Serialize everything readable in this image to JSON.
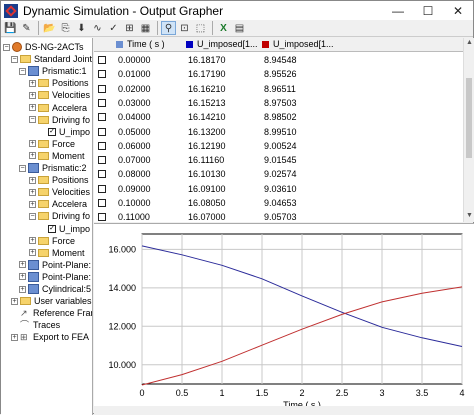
{
  "window": {
    "title": "Dynamic Simulation - Output Grapher",
    "minimize": "—",
    "maximize": "☐",
    "close": "✕"
  },
  "toolbar": {
    "icons": [
      "save-icon",
      "open-icon",
      "cut-icon",
      "copy-icon",
      "paste-icon",
      "print-icon",
      "undo-icon",
      "redo-icon",
      "export-icon",
      "import-icon",
      "graph-icon",
      "zoom-icon",
      "fit-icon",
      "excel-icon",
      "calc-icon"
    ]
  },
  "tree": {
    "items": [
      {
        "label": "DS-NG-2ACTs",
        "icon": "gear-icon",
        "expander": "−",
        "level": 0
      },
      {
        "label": "Standard Joints",
        "icon": "folder-icon",
        "expander": "−",
        "level": 1
      },
      {
        "label": "Prismatic:1",
        "icon": "joint-icon",
        "expander": "−",
        "level": 2
      },
      {
        "label": "Positions",
        "icon": "folder-icon",
        "expander": "+",
        "level": 3
      },
      {
        "label": "Velocities",
        "icon": "folder-icon",
        "expander": "+",
        "level": 3
      },
      {
        "label": "Accelera",
        "icon": "folder-icon",
        "expander": "+",
        "level": 3
      },
      {
        "label": "Driving fo",
        "icon": "folder-icon",
        "expander": "−",
        "level": 3
      },
      {
        "label": "U_impo",
        "icon": "checked-box-icon",
        "expander": "",
        "level": 4
      },
      {
        "label": "Force",
        "icon": "folder-icon",
        "expander": "+",
        "level": 3
      },
      {
        "label": "Moment",
        "icon": "folder-icon",
        "expander": "+",
        "level": 3
      },
      {
        "label": "Prismatic:2",
        "icon": "joint-icon",
        "expander": "−",
        "level": 2
      },
      {
        "label": "Positions",
        "icon": "folder-icon",
        "expander": "+",
        "level": 3
      },
      {
        "label": "Velocities",
        "icon": "folder-icon",
        "expander": "+",
        "level": 3
      },
      {
        "label": "Accelera",
        "icon": "folder-icon",
        "expander": "+",
        "level": 3
      },
      {
        "label": "Driving fo",
        "icon": "folder-icon",
        "expander": "−",
        "level": 3
      },
      {
        "label": "U_impo",
        "icon": "checked-box-icon",
        "expander": "",
        "level": 4
      },
      {
        "label": "Force",
        "icon": "folder-icon",
        "expander": "+",
        "level": 3
      },
      {
        "label": "Moment",
        "icon": "folder-icon",
        "expander": "+",
        "level": 3
      },
      {
        "label": "Point-Plane:",
        "icon": "joint-icon",
        "expander": "+",
        "level": 2
      },
      {
        "label": "Point-Plane:",
        "icon": "joint-icon",
        "expander": "+",
        "level": 2
      },
      {
        "label": "Cylindrical:5",
        "icon": "joint-icon",
        "expander": "+",
        "level": 2
      },
      {
        "label": "User variables",
        "icon": "folder-icon",
        "expander": "+",
        "level": 1
      },
      {
        "label": "Reference Fram",
        "icon": "frame-icon",
        "expander": "",
        "level": 1
      },
      {
        "label": "Traces",
        "icon": "trace-icon",
        "expander": "",
        "level": 1
      },
      {
        "label": "Export to FEA",
        "icon": "export-icon",
        "expander": "+",
        "level": 1
      }
    ]
  },
  "grid": {
    "headers": [
      {
        "label": "Time ( s )",
        "color": ""
      },
      {
        "label": "U_imposed[1...",
        "color": "#0000c0"
      },
      {
        "label": "U_imposed[1...",
        "color": "#c00000"
      }
    ],
    "rows": [
      [
        "0.00000",
        "16.18170",
        "8.94548"
      ],
      [
        "0.01000",
        "16.17190",
        "8.95526"
      ],
      [
        "0.02000",
        "16.16210",
        "8.96511"
      ],
      [
        "0.03000",
        "16.15213",
        "8.97503"
      ],
      [
        "0.04000",
        "16.14210",
        "8.98502"
      ],
      [
        "0.05000",
        "16.13200",
        "8.99510"
      ],
      [
        "0.06000",
        "16.12190",
        "9.00524"
      ],
      [
        "0.07000",
        "16.11160",
        "9.01545"
      ],
      [
        "0.08000",
        "16.10130",
        "9.02574"
      ],
      [
        "0.09000",
        "16.09100",
        "9.03610"
      ],
      [
        "0.10000",
        "16.08050",
        "9.04653"
      ],
      [
        "0.11000",
        "16.07000",
        "9.05703"
      ]
    ]
  },
  "chart_data": {
    "type": "line",
    "xlabel": "Time ( s )",
    "ylabel": "",
    "xlim": [
      0,
      4
    ],
    "ylim": [
      9.0,
      16.8
    ],
    "xticks": [
      "0",
      "0.5",
      "1",
      "1.5",
      "2",
      "2.5",
      "3",
      "3.5",
      "4"
    ],
    "yticks": [
      "10.000",
      "12.000",
      "14.000",
      "16.000"
    ],
    "grid": true,
    "series": [
      {
        "color": "#2b2b9a",
        "x": [
          0,
          0.5,
          1,
          1.5,
          2,
          2.5,
          3,
          3.5,
          4
        ],
        "values": [
          16.18,
          15.72,
          15.17,
          14.47,
          13.58,
          12.73,
          11.95,
          11.4,
          10.95
        ]
      },
      {
        "color": "#c03030",
        "x": [
          0,
          0.5,
          1,
          1.5,
          2,
          2.5,
          3,
          3.5,
          4
        ],
        "values": [
          8.95,
          9.49,
          10.18,
          11.02,
          11.85,
          12.62,
          13.27,
          13.72,
          14.05
        ]
      }
    ]
  }
}
